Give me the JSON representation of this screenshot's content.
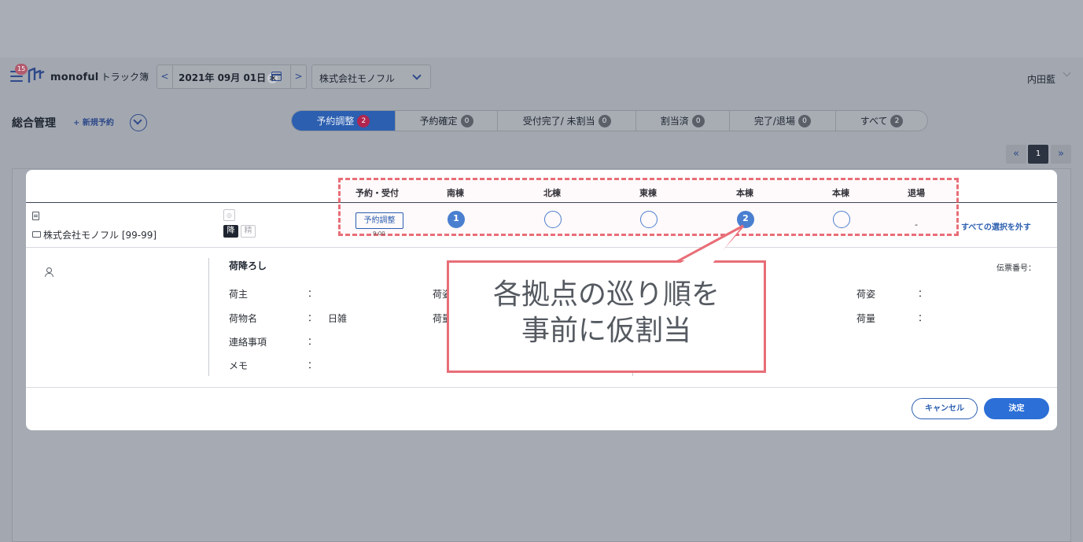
{
  "header": {
    "notification_count": "15",
    "logo_name": "monoful",
    "logo_product": "トラック簿",
    "date_label": "2021年 09月 01日",
    "day_of_week": "水",
    "prev_label": "<",
    "next_label": ">",
    "company": "株式会社モノフル",
    "user": "内田藍"
  },
  "toolbar": {
    "title": "総合管理",
    "new_booking": "+ 新規予約"
  },
  "tabs": [
    {
      "label": "予約調整",
      "count": "2"
    },
    {
      "label": "予約確定",
      "count": "0"
    },
    {
      "label": "受付完了/ 未割当",
      "count": "0"
    },
    {
      "label": "割当済",
      "count": "0"
    },
    {
      "label": "完了/退場",
      "count": "0"
    },
    {
      "label": "すべて",
      "count": "2"
    }
  ],
  "pagination": {
    "first": "«",
    "current": "1",
    "last": "»"
  },
  "modal": {
    "columns": [
      "予約・受付",
      "南棟",
      "北棟",
      "東棟",
      "本棟",
      "本棟",
      "退場"
    ],
    "row": {
      "company": "株式会社モノフル [99-99]",
      "tag_unload": "降",
      "tag_fine": "精",
      "small_badge": "◎",
      "status_button": "予約調整",
      "status_time": "9:00",
      "stops": [
        "1",
        "",
        "",
        "2",
        ""
      ],
      "exit_value": "-",
      "deselect_all": "すべての選択を外す"
    },
    "detail": {
      "section_title": "荷降ろし",
      "slip_number_label": "伝票番号：",
      "colon": "：",
      "shipper_label": "荷主",
      "item_name_label": "荷物名",
      "item_name_value": "日雑",
      "contact_label": "連絡事項",
      "memo_label": "メモ",
      "mid_label_1": "荷姿",
      "mid_label_2": "荷量",
      "right_label_1": "荷姿",
      "right_label_2": "荷量"
    },
    "cancel_label": "キャンセル",
    "confirm_label": "決定"
  },
  "callout": {
    "line1": "各拠点の巡り順を",
    "line2": "事前に仮割当"
  }
}
